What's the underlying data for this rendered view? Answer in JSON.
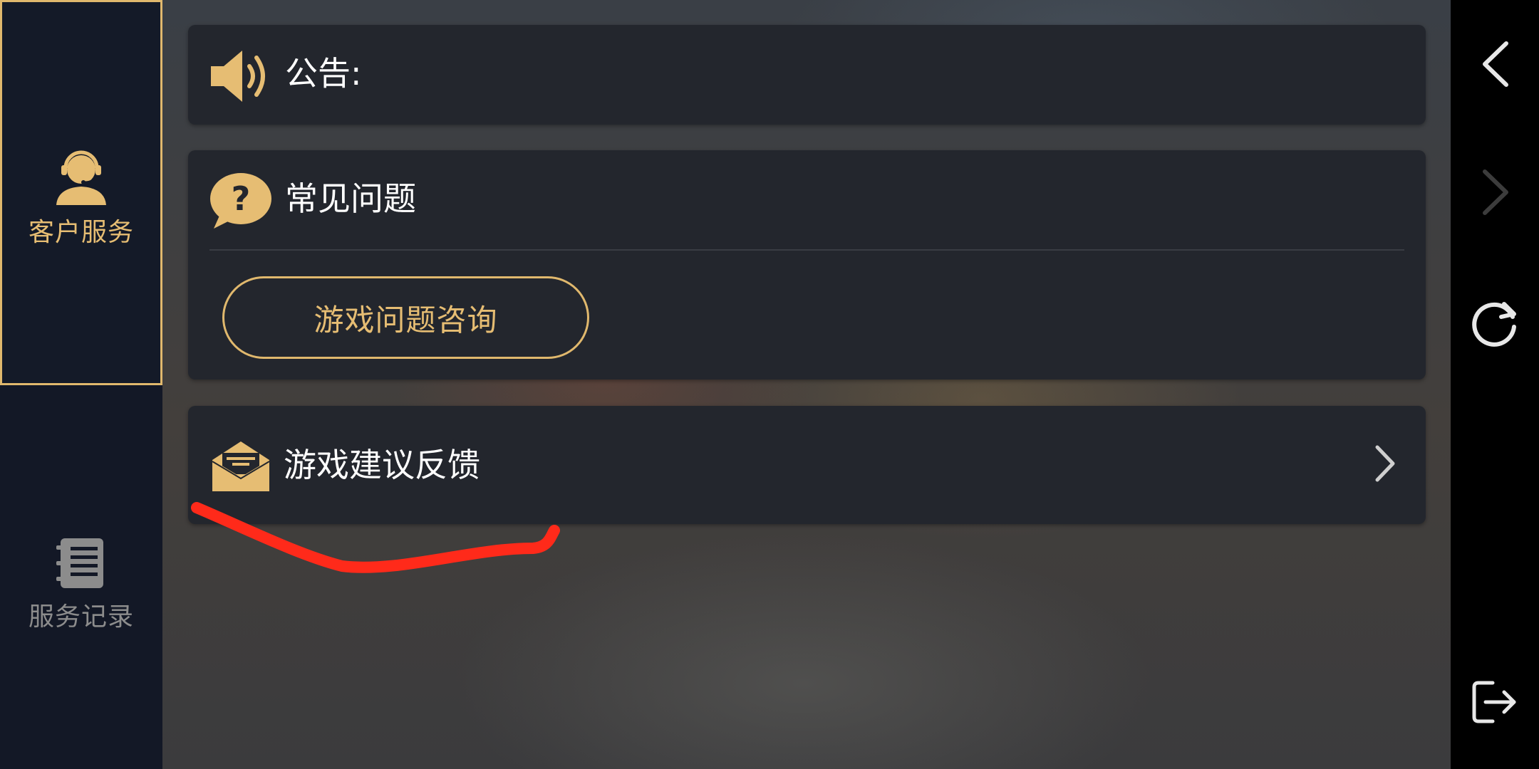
{
  "sidebar": {
    "tabs": [
      {
        "label": "客户服务",
        "icon": "customer-service-icon",
        "active": true
      },
      {
        "label": "服务记录",
        "icon": "service-record-icon",
        "active": false
      }
    ]
  },
  "notice": {
    "label": "公告:",
    "icon": "speaker-icon"
  },
  "faq": {
    "title": "常见问题",
    "icon": "question-bubble-icon",
    "button_label": "游戏问题咨询"
  },
  "feedback": {
    "title": "游戏建议反馈",
    "icon": "envelope-icon",
    "chevron_icon": "chevron-right-icon"
  },
  "navbar": {
    "buttons": [
      "back-icon",
      "forward-icon",
      "refresh-icon",
      "exit-icon"
    ]
  },
  "colors": {
    "accent": "#e0b86d",
    "sidebar_bg": "#131826",
    "card_bg": "#23262d",
    "annotation": "#ff2a1a"
  }
}
